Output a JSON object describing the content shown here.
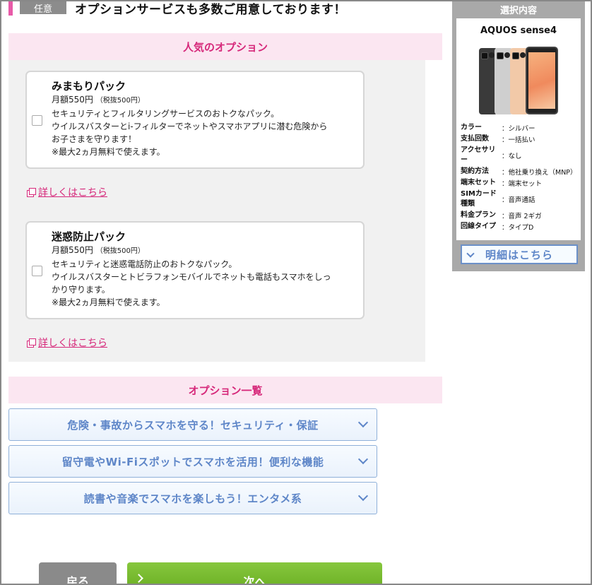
{
  "heading": {
    "tag": "任意",
    "title": "オプションサービスも多数ご用意しております！"
  },
  "popular": {
    "title": "人気のオプション",
    "options": [
      {
        "name": "みまもりパック",
        "price": "月額550円",
        "tax": "（税抜500円）",
        "desc1": "セキュリティとフィルタリングサービスのおトクなパック。",
        "desc2": "ウイルスバスターとi-フィルターでネットやスマホアプリに潜む危険から",
        "desc3": "お子さまを守ります！",
        "note": "※最大2ヵ月無料で使えます。",
        "link": "詳しくはこちら"
      },
      {
        "name": "迷惑防止パック",
        "price": "月額550円",
        "tax": "（税抜500円）",
        "desc1": "セキュリティと迷惑電話防止のおトクなパック。",
        "desc2": "ウイルスバスターとトビラフォンモバイルでネットも電話もスマホをしっ",
        "desc3": "かり守ります。",
        "note": "※最大2ヵ月無料で使えます。",
        "link": "詳しくはこちら"
      }
    ]
  },
  "option_list": {
    "title": "オプション一覧",
    "items": [
      "危険・事故からスマホを守る！セキュリティ・保証",
      "留守電やWi-Fiスポットでスマホを活用！便利な機能",
      "読書や音楽でスマホを楽しもう！エンタメ系"
    ]
  },
  "buttons": {
    "back": "戻る",
    "next": "次へ"
  },
  "sidebar": {
    "title": "選択内容",
    "model": "AQUOS sense4",
    "specs": [
      {
        "key": "カラー",
        "value": "：シルバー"
      },
      {
        "key": "支払回数",
        "value": "：一括払い"
      },
      {
        "key": "アクセサリー",
        "value": "：なし"
      },
      {
        "key": "契約方法",
        "value": "：他社乗り換え（MNP）"
      },
      {
        "key": "端末セット",
        "value": "：端末セット"
      },
      {
        "key": "SIMカード種類",
        "value": "：音声通話"
      },
      {
        "key": "料金プラン",
        "value": "：音声 2ギガ"
      },
      {
        "key": "回線タイプ",
        "value": "：タイプD"
      }
    ],
    "detail_button": "明細はこちら"
  },
  "colors": {
    "accent_pink": "#d6287a",
    "header_pink_bg": "#fbe6f1",
    "link_blue": "#5e86c8",
    "next_green": "#6aae23"
  }
}
